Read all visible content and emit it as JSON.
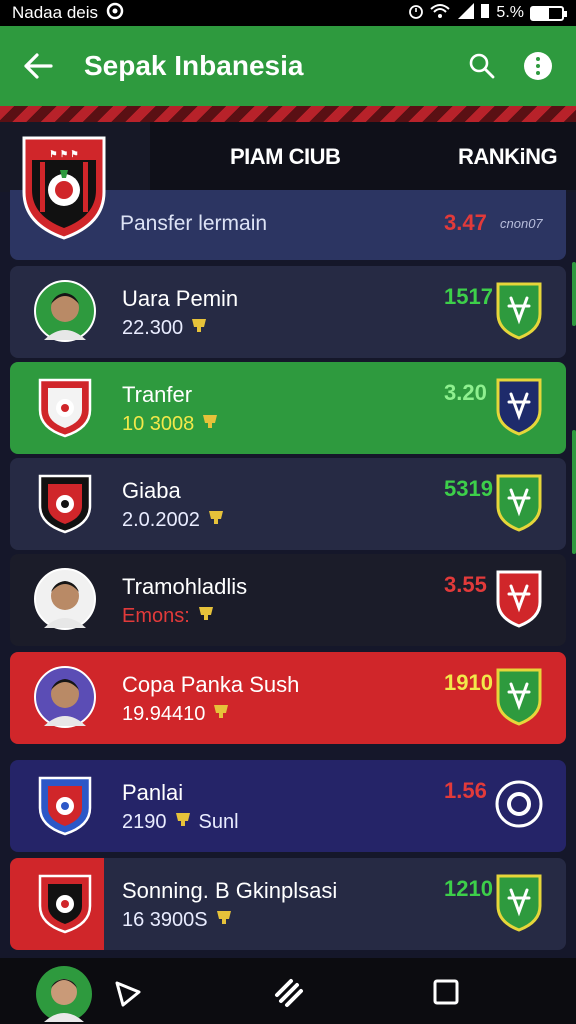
{
  "status_bar": {
    "left_text": "Nadaa deis",
    "right_text": "5.%"
  },
  "app_bar": {
    "title": "Sepak Inbanesia"
  },
  "tabs": {
    "club": "PIAM CIUB",
    "ranking": "RANKiNG"
  },
  "header_row": {
    "label": "Pansfer lermain",
    "score": "3.47",
    "small": "cnon07"
  },
  "rows": [
    {
      "name": "Uara Pemin",
      "sub": "22.300",
      "score": "1517",
      "bg": "#262a44",
      "score_color": "#3dcf4a",
      "sub_color": "#e9ecff"
    },
    {
      "name": "Tranfer",
      "sub": "10 3008",
      "score": "3.20",
      "bg": "#2e9a3e",
      "score_color": "#8ff08f",
      "sub_color": "#f2e84a"
    },
    {
      "name": "Giaba",
      "sub": "2.0.2002",
      "score": "5319",
      "bg": "#262a44",
      "score_color": "#3dcf4a",
      "sub_color": "#e9ecff"
    },
    {
      "name": "Tramohladlis",
      "sub": "Emons:",
      "score": "3.55",
      "bg": "#1b1c29",
      "score_color": "#e23a3a",
      "sub_color": "#e23a3a"
    },
    {
      "name": "Copa Panka Sush",
      "sub": "19.94410",
      "score": "1910",
      "bg": "#d0262a",
      "score_color": "#f2e84a",
      "sub_color": "#ffffff"
    },
    {
      "name": "Panlai",
      "sub": "2190",
      "sub2": "Sunl",
      "score": "1.56",
      "bg": "#252468",
      "score_color": "#e23a3a",
      "sub_color": "#e9ecff"
    },
    {
      "name": "Sonning. B Gkinplsasi",
      "sub": "16 3900S",
      "score": "1210",
      "bg": "#262a44",
      "score_color": "#3dcf4a",
      "sub_color": "#e9ecff"
    }
  ],
  "icons": {
    "back": "arrow-left-icon",
    "search": "search-icon",
    "more": "more-vertical-icon",
    "nav_back": "triangle-back-icon",
    "nav_home": "home-icon",
    "nav_recent": "square-recent-icon"
  }
}
